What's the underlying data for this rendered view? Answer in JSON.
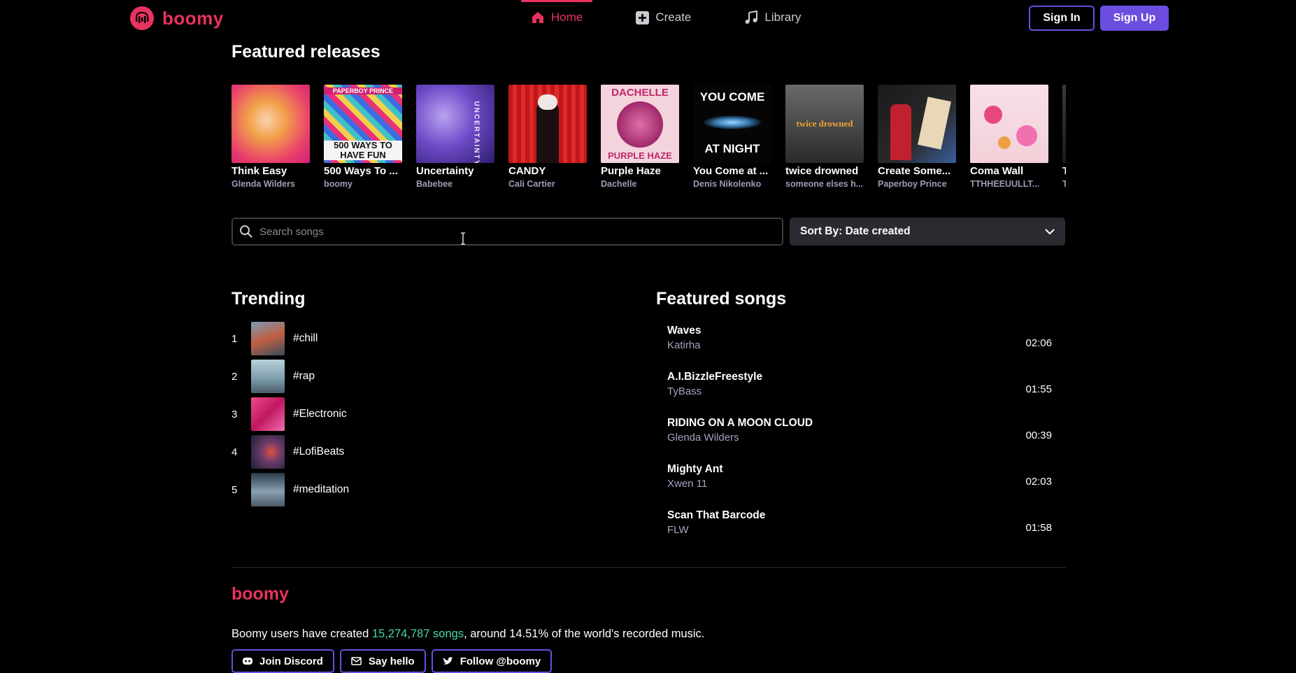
{
  "brand": {
    "name": "boomy"
  },
  "nav": [
    {
      "label": "Home",
      "icon": "home-icon",
      "active": true
    },
    {
      "label": "Create",
      "icon": "plus-square-icon",
      "active": false
    },
    {
      "label": "Library",
      "icon": "music-note-icon",
      "active": false
    }
  ],
  "auth": {
    "sign_in": "Sign In",
    "sign_up": "Sign Up"
  },
  "featured_releases": {
    "title": "Featured releases",
    "items": [
      {
        "title": "Think Easy",
        "artist": "Glenda Wilders"
      },
      {
        "title": "500 Ways To ...",
        "artist": "boomy"
      },
      {
        "title": "Uncertainty",
        "artist": "Babebee"
      },
      {
        "title": "CANDY",
        "artist": "Cali Cartier"
      },
      {
        "title": "Purple Haze",
        "artist": "Dachelle"
      },
      {
        "title": "You Come at ...",
        "artist": "Denis Nikolenko"
      },
      {
        "title": "twice drowned",
        "artist": "someone elses h..."
      },
      {
        "title": "Create Some...",
        "artist": "Paperboy Prince"
      },
      {
        "title": "Coma Wall",
        "artist": "TTHHEEUULLT..."
      },
      {
        "title": "T",
        "artist": "T"
      }
    ],
    "cover_texts": {
      "c2_top": "PAPERBOY PRINCE",
      "c2_bottom": "500 WAYS TO HAVE FUN",
      "c3": "UNCERTAINTY",
      "c5_top": "DACHELLE",
      "c5_bottom": "PURPLE HAZE",
      "c6_top": "YOU COME",
      "c6_bottom": "AT NIGHT",
      "c7": "twice drowned"
    }
  },
  "search": {
    "placeholder": "Search songs"
  },
  "sort": {
    "label": "Sort By: Date created"
  },
  "trending": {
    "title": "Trending",
    "items": [
      {
        "rank": "1",
        "tag": "#chill"
      },
      {
        "rank": "2",
        "tag": "#rap"
      },
      {
        "rank": "3",
        "tag": "#Electronic"
      },
      {
        "rank": "4",
        "tag": "#LofiBeats"
      },
      {
        "rank": "5",
        "tag": "#meditation"
      }
    ]
  },
  "featured_songs": {
    "title": "Featured songs",
    "items": [
      {
        "name": "Waves",
        "artist": "Katirha",
        "duration": "02:06"
      },
      {
        "name": "A.I.BizzleFreestyle",
        "artist": "TyBass",
        "duration": "01:55"
      },
      {
        "name": "RIDING ON A MOON CLOUD",
        "artist": "Glenda Wilders",
        "duration": "00:39"
      },
      {
        "name": "Mighty Ant",
        "artist": "Xwen 11",
        "duration": "02:03"
      },
      {
        "name": "Scan That Barcode",
        "artist": "FLW",
        "duration": "01:58"
      }
    ]
  },
  "footer": {
    "brand": "boomy",
    "stat_prefix": "Boomy users have created ",
    "stat_highlight": "15,274,787 songs",
    "stat_suffix": ", around 14.51% of the world's recorded music.",
    "buttons": [
      {
        "label": "Join Discord",
        "icon": "discord-icon"
      },
      {
        "label": "Say hello",
        "icon": "mail-icon"
      },
      {
        "label": "Follow @boomy",
        "icon": "twitter-icon"
      }
    ]
  },
  "colors": {
    "brand": "#e8325f",
    "accent": "#6c4de0",
    "highlight": "#4ad8a6"
  }
}
